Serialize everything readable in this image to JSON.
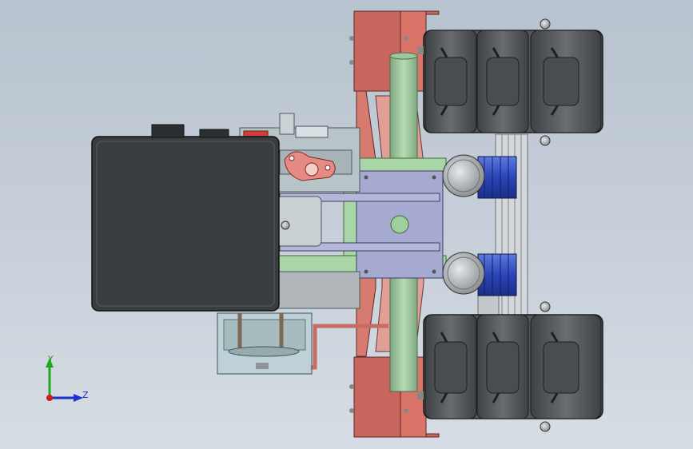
{
  "app": {
    "title": "",
    "view": "Top"
  },
  "triad": {
    "y_label": "Y",
    "z_label": "Z",
    "y_color": "#1fa81f",
    "z_color": "#1f2fd0",
    "origin_color": "#d01a1a"
  },
  "model": {
    "parts": [
      {
        "name": "engine-block",
        "color": "#3a3d40"
      },
      {
        "name": "chassis-frame",
        "color": "#a9d6a6"
      },
      {
        "name": "mounting-plate",
        "color": "#a6a9cf"
      },
      {
        "name": "side-brackets",
        "color": "#c96a62"
      },
      {
        "name": "drive-motors",
        "color": "#2f4fc4"
      },
      {
        "name": "wheel-treads",
        "color": "#4a4d50"
      },
      {
        "name": "gearbox-housing",
        "color": "#b9c4c9"
      },
      {
        "name": "transparent-tank",
        "color": "#b8cfd3"
      }
    ]
  }
}
